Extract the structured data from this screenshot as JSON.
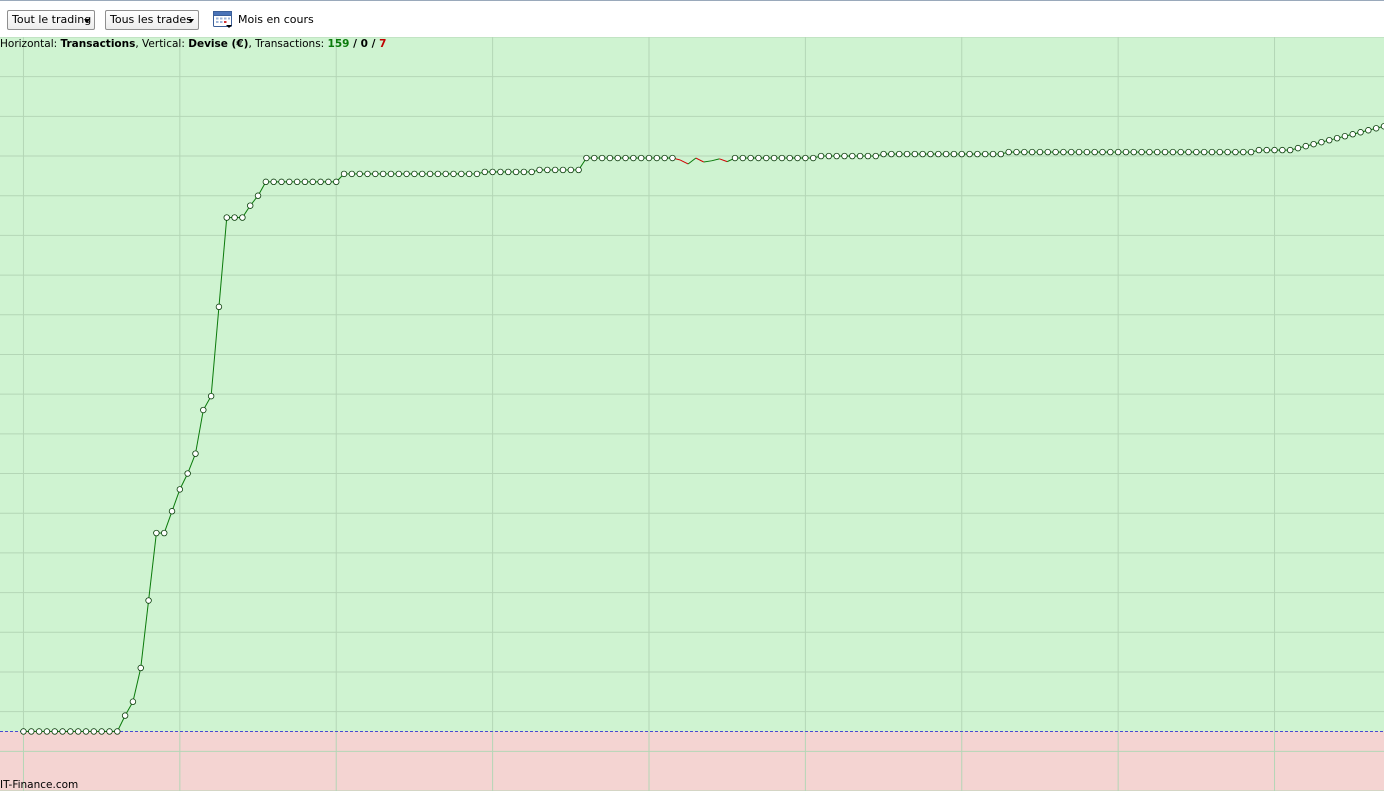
{
  "toolbar": {
    "filter_trading": "Tout le trading",
    "filter_trades": "Tous les trades",
    "period_label": "Mois en cours"
  },
  "info": {
    "horizontal_prefix": "Horizontal: ",
    "horizontal_value": "Transactions",
    "vertical_prefix": ", Vertical: ",
    "vertical_value": "Devise (€)",
    "transactions_prefix": ", Transactions: ",
    "count_positive": "159",
    "separator": " / ",
    "count_neutral": "0",
    "count_negative": "7"
  },
  "watermark": "IT-Finance.com",
  "colors": {
    "positive_zone": "#cff3d1",
    "negative_zone": "#f4d4d2",
    "line_up": "#0a7a0a",
    "line_down": "#d00000",
    "grid": "#b4d6b6",
    "baseline": "#4a4ad0"
  },
  "chart_data": {
    "type": "line",
    "title": "",
    "xlabel": "Transactions",
    "ylabel": "Devise (€)",
    "x_axis": "transaction index",
    "grid": true,
    "zero_line": "dashed",
    "ylim": [
      -15,
      175
    ],
    "xlim": [
      -3,
      174
    ],
    "values": [
      0,
      0,
      0,
      0,
      0,
      0,
      0,
      0,
      0,
      0,
      0,
      0,
      0,
      4,
      7.5,
      16,
      33,
      50,
      50,
      55.5,
      61,
      65,
      70,
      81,
      84.5,
      107,
      129.5,
      129.5,
      129.5,
      132.5,
      135,
      138.5,
      138.5,
      138.5,
      138.5,
      138.5,
      138.5,
      138.5,
      138.5,
      138.5,
      138.5,
      140.5,
      140.5,
      140.5,
      140.5,
      140.5,
      140.5,
      140.5,
      140.5,
      140.5,
      140.5,
      140.5,
      140.5,
      140.5,
      140.5,
      140.5,
      140.5,
      140.5,
      140.5,
      141,
      141,
      141,
      141,
      141,
      141,
      141,
      141.5,
      141.5,
      141.5,
      141.5,
      141.5,
      141.5,
      144.5,
      144.5,
      144.5,
      144.5,
      144.5,
      144.5,
      144.5,
      144.5,
      144.5,
      144.5,
      144.5,
      144.5,
      144.5,
      144.5,
      144.5,
      144.5,
      144.5,
      144.5,
      144.5,
      144.5,
      144.5,
      144.5,
      144.5,
      144.5,
      144.5,
      144.5,
      144.5,
      144.5,
      144.5,
      144.5,
      145,
      145,
      145,
      145,
      145,
      145,
      145,
      145,
      145.5,
      145.5,
      145.5,
      145.5,
      145.5,
      145.5,
      145.5,
      145.5,
      145.5,
      145.5,
      145.5,
      145.5,
      145.5,
      145.5,
      145.5,
      145.5,
      146,
      146,
      146,
      146,
      146,
      146,
      146,
      146,
      146,
      146,
      146,
      146,
      146,
      146,
      146,
      146,
      146,
      146,
      146,
      146,
      146,
      146,
      146,
      146,
      146,
      146,
      146,
      146,
      146,
      146,
      146,
      146,
      146.5,
      146.5,
      146.5,
      146.5,
      146.5,
      147,
      147.5,
      148,
      148.5,
      149,
      149.5,
      150,
      150.5,
      151,
      151.5,
      152,
      152.5,
      153,
      153.5,
      154
    ],
    "losing_transactions": [
      84,
      85,
      86,
      87,
      88,
      89,
      90
    ],
    "losing_values": [
      144,
      143,
      144.5,
      143.5,
      143.8,
      144.3,
      143.6
    ],
    "marker_after_losses": [
      91
    ]
  }
}
